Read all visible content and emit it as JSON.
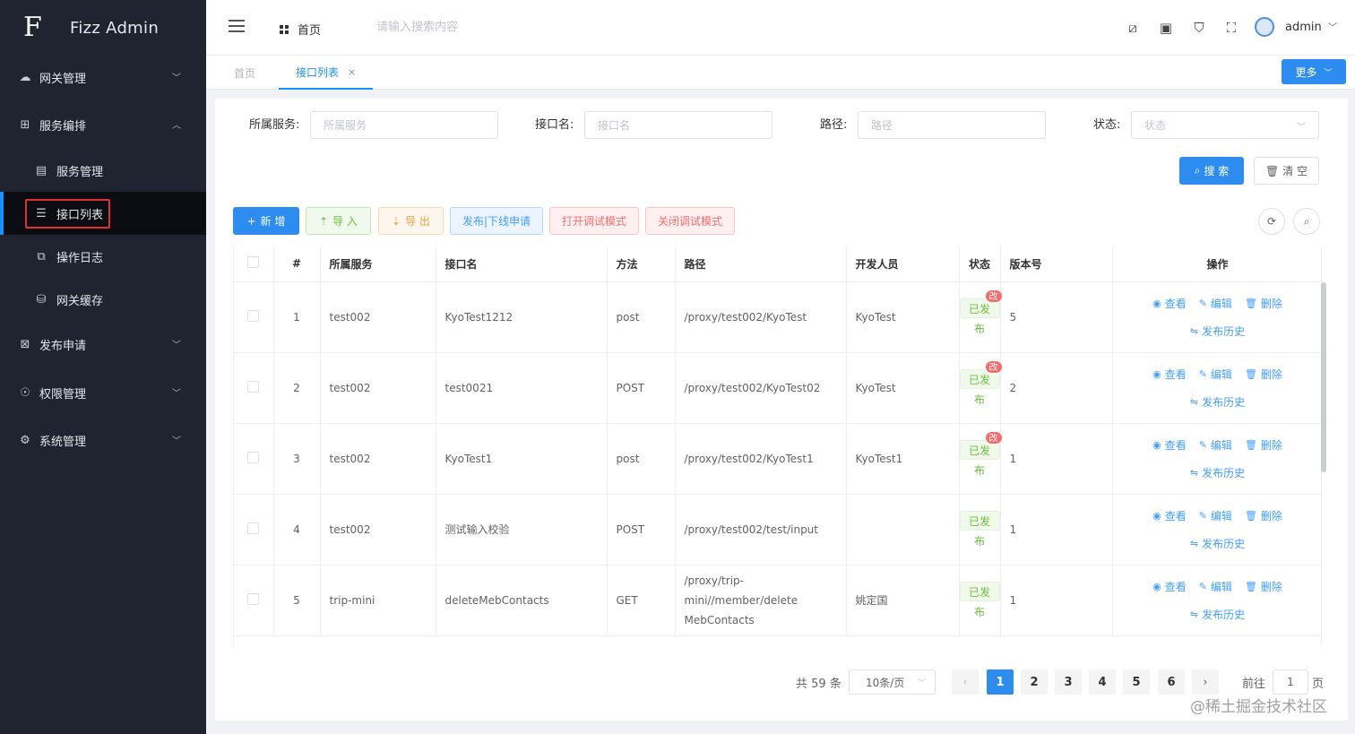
{
  "app": {
    "title": "Fizz Admin",
    "logo_letter": "F"
  },
  "sidebar": {
    "items": [
      {
        "label": "网关管理",
        "icon": "cloud-icon",
        "glyph": "☁",
        "expanded": false
      },
      {
        "label": "服务编排",
        "icon": "grid-icon",
        "glyph": "⊞",
        "expanded": true
      },
      {
        "label": "服务管理",
        "icon": "server-icon",
        "glyph": "▤",
        "sub": true
      },
      {
        "label": "接口列表",
        "icon": "list-icon",
        "glyph": "☰",
        "sub": true,
        "active": true
      },
      {
        "label": "操作日志",
        "icon": "log-icon",
        "glyph": "⧉",
        "sub": true
      },
      {
        "label": "网关缓存",
        "icon": "cache-icon",
        "glyph": "⛁",
        "sub": true
      },
      {
        "label": "发布申请",
        "icon": "publish-icon",
        "glyph": "⊠",
        "expanded": false
      },
      {
        "label": "权限管理",
        "icon": "lock-icon",
        "glyph": "🔒",
        "expanded": false
      },
      {
        "label": "系统管理",
        "icon": "gear-icon",
        "glyph": "⚙",
        "expanded": false
      }
    ]
  },
  "topnav": {
    "home_label": "首页",
    "search_placeholder": "请输入搜索内容",
    "user": "admin"
  },
  "tabs": [
    {
      "label": "首页",
      "active": false
    },
    {
      "label": "接口列表",
      "active": true,
      "close": "×"
    }
  ],
  "more_label": "更多",
  "filters": {
    "service_label": "所属服务:",
    "service_placeholder": "所属服务",
    "api_label": "接口名:",
    "api_placeholder": "接口名",
    "path_label": "路径:",
    "path_placeholder": "路径",
    "status_label": "状态:",
    "status_placeholder": "状态"
  },
  "actions": {
    "search": "搜 索",
    "clear": "清 空",
    "add": "新 增",
    "import": "导 入",
    "export": "导 出",
    "publish_request": "发布|下线申请",
    "debug_on": "打开调试模式",
    "debug_off": "关闭调试模式"
  },
  "table": {
    "headers": [
      "#",
      "所属服务",
      "接口名",
      "方法",
      "路径",
      "开发人员",
      "状态",
      "版本号",
      "操作"
    ],
    "ops": {
      "view": "查看",
      "edit": "编辑",
      "delete": "删除",
      "history": "发布历史"
    },
    "rows": [
      {
        "no": "1",
        "service": "test002",
        "api": "KyoTest1212",
        "method": "post",
        "path": "/proxy/test002/KyoTest",
        "dev": "KyoTest",
        "status": "已发布",
        "badge": "改",
        "version": "5"
      },
      {
        "no": "2",
        "service": "test002",
        "api": "test0021",
        "method": "POST",
        "path": "/proxy/test002/KyoTest02",
        "dev": "KyoTest",
        "status": "已发布",
        "badge": "改",
        "version": "2"
      },
      {
        "no": "3",
        "service": "test002",
        "api": "KyoTest1",
        "method": "post",
        "path": "/proxy/test002/KyoTest1",
        "dev": "KyoTest1",
        "status": "已发布",
        "badge": "改",
        "version": "1"
      },
      {
        "no": "4",
        "service": "test002",
        "api": "测试输入校验",
        "method": "POST",
        "path": "/proxy/test002/test/input",
        "dev": "",
        "status": "已发布",
        "badge": "",
        "version": "1"
      },
      {
        "no": "5",
        "service": "trip-mini",
        "api": "deleteMebContacts",
        "method": "GET",
        "path": "/proxy/trip-mini//member/delete MebContacts",
        "dev": "姚定国",
        "status": "已发布",
        "badge": "",
        "version": "1"
      }
    ]
  },
  "pagination": {
    "total": "共 59 条",
    "page_size": "10条/页",
    "pages": [
      "1",
      "2",
      "3",
      "4",
      "5",
      "6"
    ],
    "current": "1",
    "goto_label": "前往",
    "goto_value": "1",
    "goto_suffix": "页"
  },
  "watermark": "@稀土掘金技术社区",
  "colors": {
    "primary": "#2d8cf0",
    "sidebar_bg": "#1f2430",
    "success": "#67c23a",
    "danger": "#f56c6c"
  }
}
